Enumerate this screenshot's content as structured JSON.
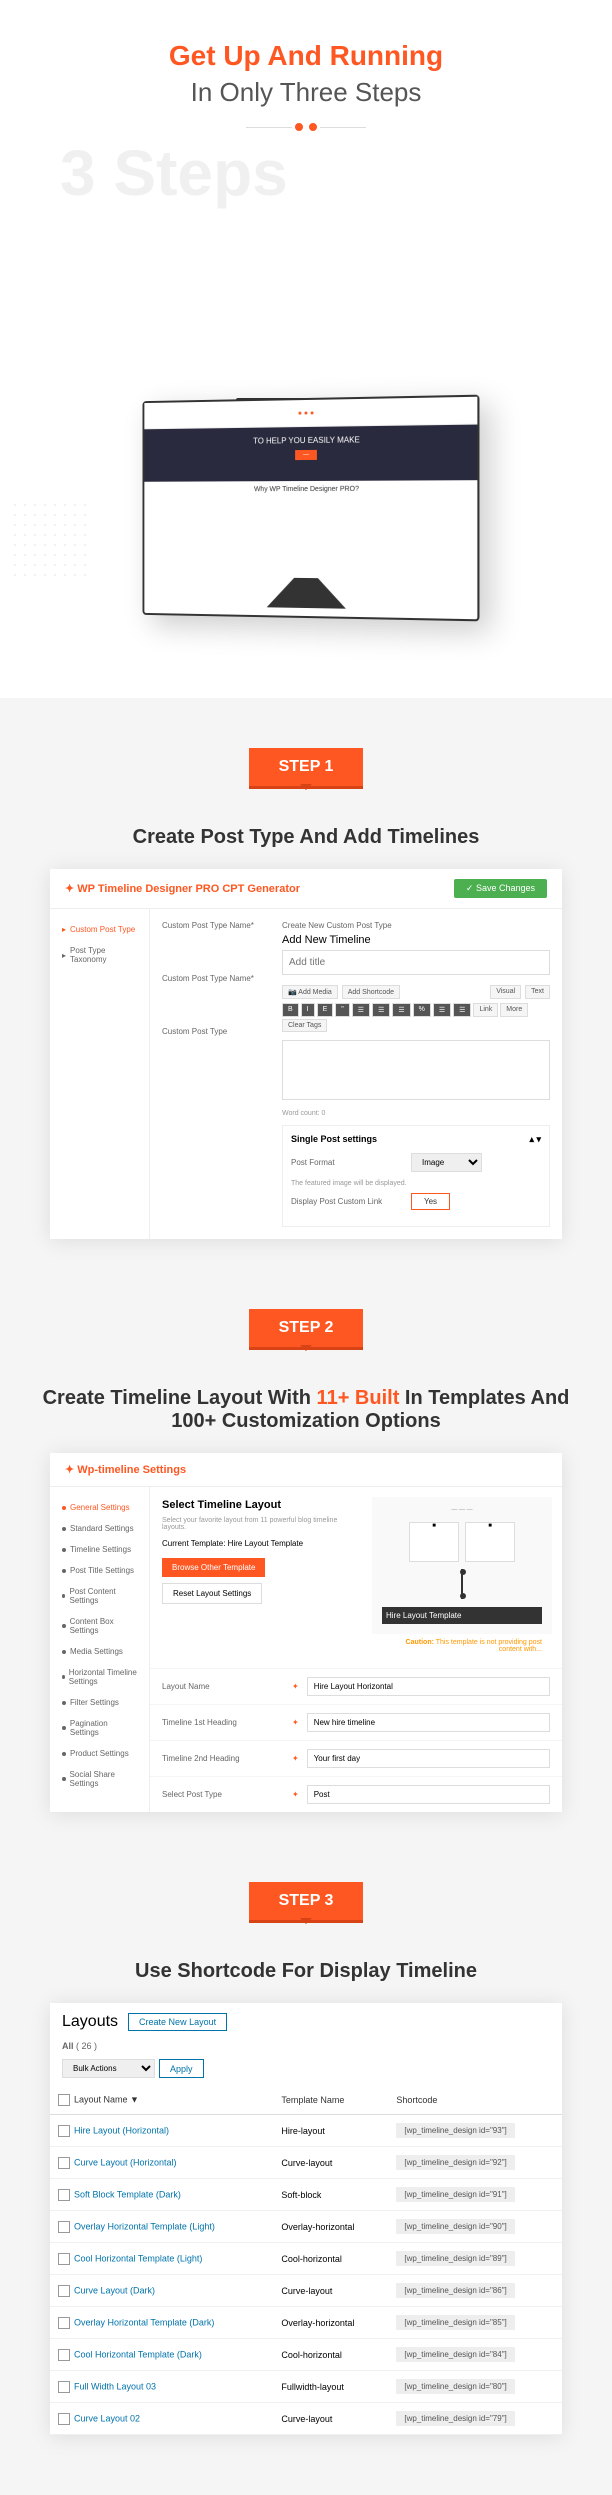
{
  "hero": {
    "title1": "Get Up And Running",
    "title2": "In Only Three Steps",
    "ghost": "3 Steps"
  },
  "monitor": {
    "banner_text": "TO HELP YOU EASILY MAKE",
    "mid_text": "Why WP Timeline Designer PRO?"
  },
  "step1": {
    "badge": "STEP 1",
    "title": "Create Post Type And Add Timelines",
    "panel_title": "WP Timeline Designer PRO CPT Generator",
    "save_btn": "✓ Save Changes",
    "sidebar": [
      {
        "label": "Custom Post Type",
        "active": true
      },
      {
        "label": "Post Type Taxonomy",
        "active": false
      }
    ],
    "section_label": "Create New Custom Post Type",
    "subtitle": "Add New Timeline",
    "title_placeholder": "Add title",
    "fields": [
      "Custom Post Type Name*",
      "Custom Post Type Name*",
      "Custom Post Type"
    ],
    "media_btn": "Add Media",
    "shortcode_btn": "Add Shortcode",
    "tools": [
      "B",
      "I",
      "E",
      "\"",
      "☰",
      "☰",
      "☰",
      "%",
      "☰",
      "☰",
      "Link",
      "More",
      "Clear Tags"
    ],
    "tabs": [
      "Visual",
      "Text"
    ],
    "word_count": "Word count: 0",
    "single_post": "Single Post settings",
    "post_format_label": "Post Format",
    "post_format_value": "Image",
    "featured_note": "The featured image will be displayed.",
    "custom_link_label": "Display Post Custom Link",
    "yes": "Yes"
  },
  "step2": {
    "badge": "STEP 2",
    "title_pre": "Create Timeline Layout With ",
    "title_highlight": "11+ Built",
    "title_post": " In Templates And 100+ Customization Options",
    "panel_title": "Wp-timeline Settings",
    "sidebar": [
      "General Settings",
      "Standard Settings",
      "Timeline Settings",
      "Post Title Settings",
      "Post Content Settings",
      "Content Box Settings",
      "Media Settings",
      "Horizontal Timeline Settings",
      "Filter Settings",
      "Pagination Settings",
      "Product Settings",
      "Social Share Settings"
    ],
    "select_layout": "Select Timeline Layout",
    "layout_desc": "Select your favorite layout from 11 powerful blog timeline layouts.",
    "current_template_label": "Current Template:",
    "current_template": "Hire Layout Template",
    "browse_btn": "Browse Other Template",
    "reset_btn": "Reset Layout Settings",
    "preview_title": "Hire Layout Template",
    "caution": "Caution:",
    "caution_text": "This template is not providing post content with...",
    "rows": [
      {
        "label": "Layout Name",
        "value": "Hire Layout Horizontal"
      },
      {
        "label": "Timeline 1st Heading",
        "value": "New hire timeline"
      },
      {
        "label": "Timeline 2nd Heading",
        "value": "Your first day"
      },
      {
        "label": "Select Post Type",
        "value": "Post"
      }
    ]
  },
  "step3": {
    "badge": "STEP 3",
    "title": "Use Shortcode For Display Timeline",
    "layouts_title": "Layouts",
    "create_btn": "Create New Layout",
    "filter_all": "All",
    "filter_count": "( 26 )",
    "bulk_label": "Bulk Actions",
    "apply_btn": "Apply",
    "headers": [
      "Layout Name ▼",
      "Template Name",
      "Shortcode"
    ],
    "rows": [
      {
        "name": "Hire Layout (Horizontal)",
        "template": "Hire-layout",
        "code": "[wp_timeline_design id=\"93\"]"
      },
      {
        "name": "Curve Layout (Horizontal)",
        "template": "Curve-layout",
        "code": "[wp_timeline_design id=\"92\"]"
      },
      {
        "name": "Soft Block Template (Dark)",
        "template": "Soft-block",
        "code": "[wp_timeline_design id=\"91\"]"
      },
      {
        "name": "Overlay Horizontal Template (Light)",
        "template": "Overlay-horizontal",
        "code": "[wp_timeline_design id=\"90\"]"
      },
      {
        "name": "Cool Horizontal Template (Light)",
        "template": "Cool-horizontal",
        "code": "[wp_timeline_design id=\"89\"]"
      },
      {
        "name": "Curve Layout (Dark)",
        "template": "Curve-layout",
        "code": "[wp_timeline_design id=\"86\"]"
      },
      {
        "name": "Overlay Horizontal Template (Dark)",
        "template": "Overlay-horizontal",
        "code": "[wp_timeline_design id=\"85\"]"
      },
      {
        "name": "Cool Horizontal Template (Dark)",
        "template": "Cool-horizontal",
        "code": "[wp_timeline_design id=\"84\"]"
      },
      {
        "name": "Full Width Layout 03",
        "template": "Fullwidth-layout",
        "code": "[wp_timeline_design id=\"80\"]"
      },
      {
        "name": "Curve Layout 02",
        "template": "Curve-layout",
        "code": "[wp_timeline_design id=\"79\"]"
      }
    ]
  }
}
